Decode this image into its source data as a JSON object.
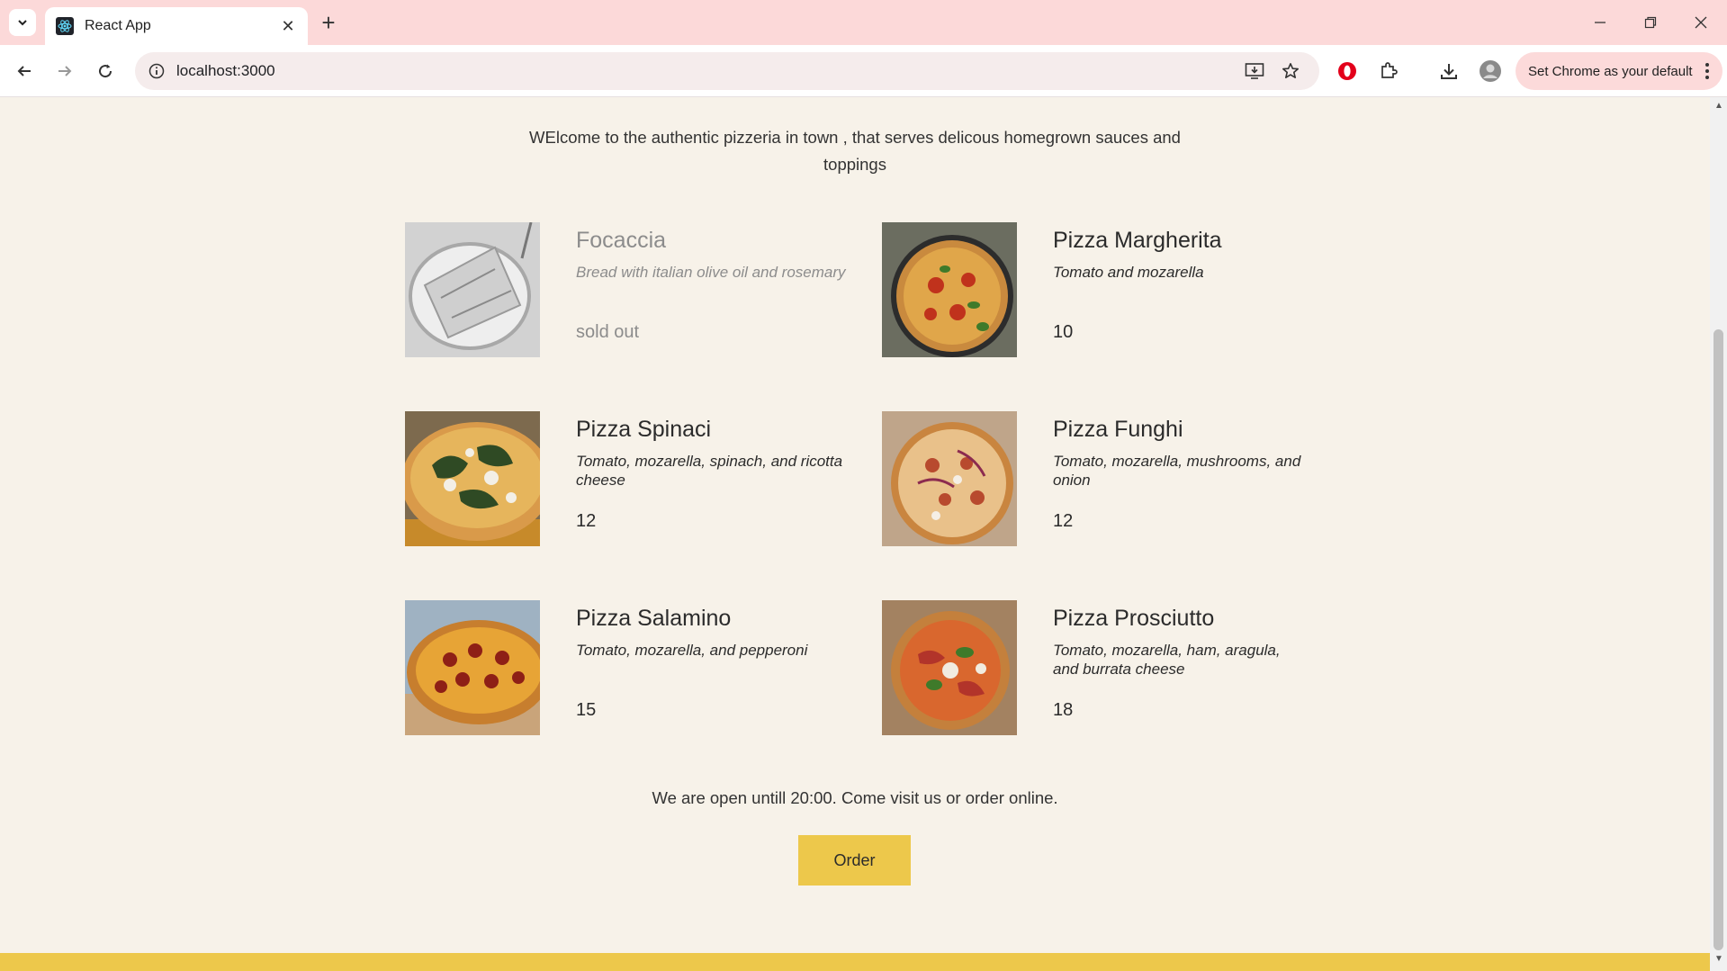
{
  "browser": {
    "tab_title": "React App",
    "url": "localhost:3000",
    "set_default_label": "Set Chrome as your default"
  },
  "welcome_text": "WElcome to the authentic pizzeria in town , that serves delicous homegrown sauces and toppings",
  "menu": [
    {
      "name": "Focaccia",
      "ingredients": "Bread with italian olive oil and rosemary",
      "price": "sold out",
      "sold_out": true
    },
    {
      "name": "Pizza Margherita",
      "ingredients": "Tomato and mozarella",
      "price": "10",
      "sold_out": false
    },
    {
      "name": "Pizza Spinaci",
      "ingredients": "Tomato, mozarella, spinach, and ricotta cheese",
      "price": "12",
      "sold_out": false
    },
    {
      "name": "Pizza Funghi",
      "ingredients": "Tomato, mozarella, mushrooms, and onion",
      "price": "12",
      "sold_out": false
    },
    {
      "name": "Pizza Salamino",
      "ingredients": "Tomato, mozarella, and pepperoni",
      "price": "15",
      "sold_out": false
    },
    {
      "name": "Pizza Prosciutto",
      "ingredients": "Tomato, mozarella, ham, aragula, and burrata cheese",
      "price": "18",
      "sold_out": false
    }
  ],
  "open_text": "We are open untill 20:00. Come visit us or order online.",
  "order_label": "Order",
  "colors": {
    "background": "#f7f2e9",
    "accent_yellow": "#edc84b",
    "tabbar": "#fcd9d9",
    "text": "#2b2b2b",
    "sold_out_text": "#8c8c8c"
  }
}
